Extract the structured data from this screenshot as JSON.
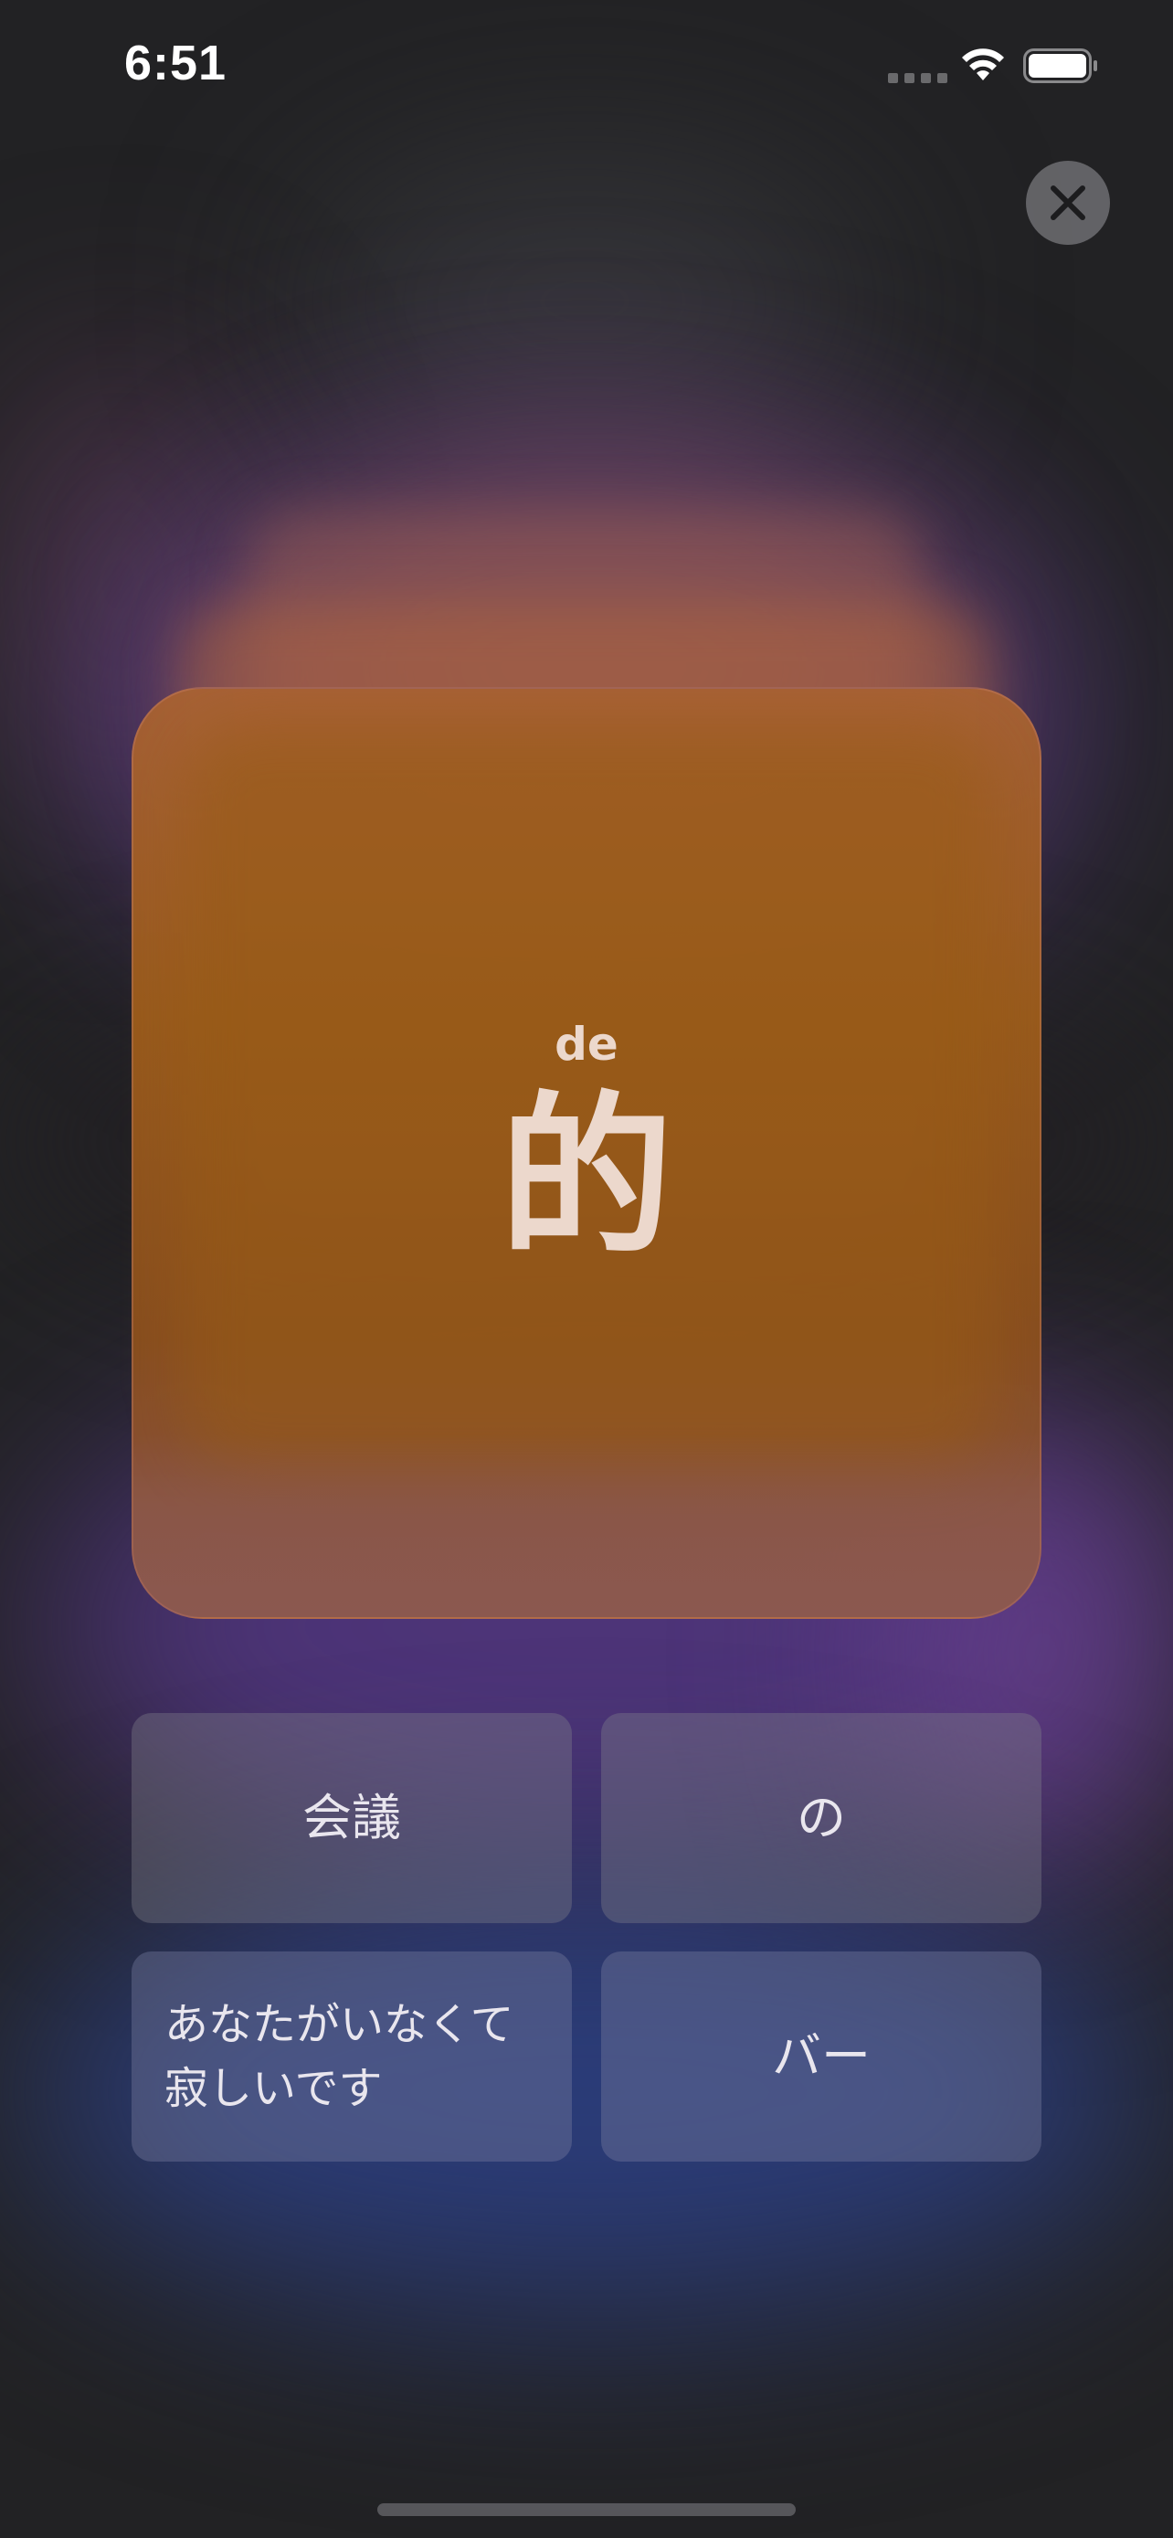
{
  "status_bar": {
    "time": "6:51"
  },
  "card": {
    "pinyin": "de",
    "character": "的"
  },
  "options": [
    {
      "label": "会議"
    },
    {
      "label": "の"
    },
    {
      "label": "あなたがいなくて寂しいです"
    },
    {
      "label": "バー"
    }
  ],
  "icons": {
    "close": "close-icon",
    "wifi": "wifi-icon",
    "battery": "battery-icon",
    "signal": "cellular-signal-icon"
  },
  "colors": {
    "background": "#222224",
    "card_orange": "#9c5c1c",
    "card_text": "#ecd8cc",
    "option_text": "#e9e6ee"
  }
}
